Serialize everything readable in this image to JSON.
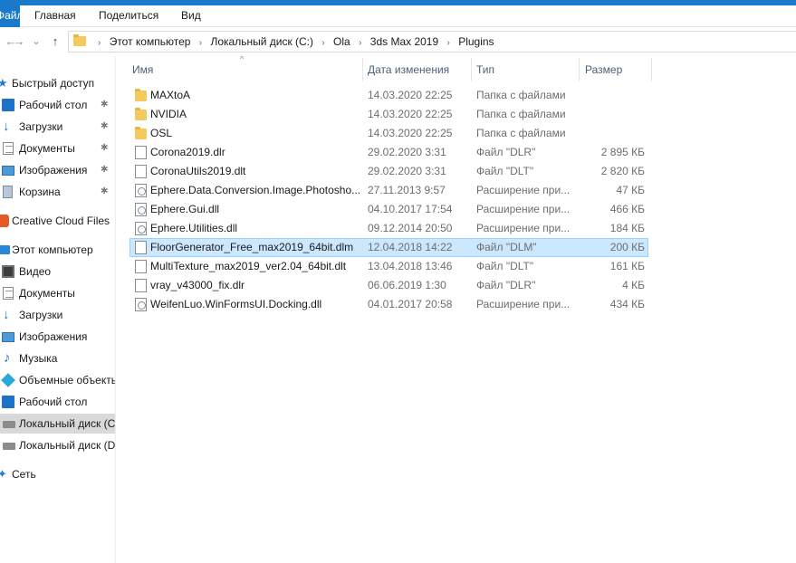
{
  "ribbon": {
    "file_tab": "Файл",
    "tabs": [
      "Главная",
      "Поделиться",
      "Вид"
    ]
  },
  "nav": {
    "back": "←",
    "forward": "→",
    "recent": "⌄",
    "up": "↑"
  },
  "address": {
    "crumbs": [
      "Этот компьютер",
      "Локальный диск (C:)",
      "Ola",
      "3ds Max 2019",
      "Plugins"
    ],
    "separator": "›"
  },
  "sidebar": {
    "items": [
      {
        "label": "Быстрый доступ",
        "icon": "star-icon",
        "pinned": false
      },
      {
        "label": "Рабочий стол",
        "icon": "desktop-icon",
        "pinned": true
      },
      {
        "label": "Загрузки",
        "icon": "download-icon",
        "pinned": true
      },
      {
        "label": "Документы",
        "icon": "documents-icon",
        "pinned": true
      },
      {
        "label": "Изображения",
        "icon": "pictures-icon",
        "pinned": true
      },
      {
        "label": "Корзина",
        "icon": "recycle-bin-icon",
        "pinned": true
      },
      {
        "label": "Creative Cloud Files",
        "icon": "creative-cloud-icon",
        "pinned": false
      },
      {
        "label": "Этот компьютер",
        "icon": "computer-icon",
        "pinned": false
      },
      {
        "label": "Видео",
        "icon": "video-icon",
        "pinned": false
      },
      {
        "label": "Документы",
        "icon": "documents-icon",
        "pinned": false
      },
      {
        "label": "Загрузки",
        "icon": "download-icon",
        "pinned": false
      },
      {
        "label": "Изображения",
        "icon": "pictures-icon",
        "pinned": false
      },
      {
        "label": "Музыка",
        "icon": "music-icon",
        "pinned": false
      },
      {
        "label": "Объемные объекты",
        "icon": "3d-objects-icon",
        "pinned": false
      },
      {
        "label": "Рабочий стол",
        "icon": "desktop-icon",
        "pinned": false
      },
      {
        "label": "Локальный диск (C:)",
        "icon": "drive-icon",
        "pinned": false
      },
      {
        "label": "Локальный диск (D:)",
        "icon": "drive-icon",
        "pinned": false
      },
      {
        "label": "Сеть",
        "icon": "network-icon",
        "pinned": false
      }
    ],
    "pin_glyph": "📌"
  },
  "columns": {
    "name": "Имя",
    "date": "Дата изменения",
    "type": "Тип",
    "size": "Размер",
    "sort_glyph": "^"
  },
  "files": [
    {
      "name": "MAXtoA",
      "date": "14.03.2020 22:25",
      "type": "Папка с файлами",
      "size": "",
      "kind": "folder"
    },
    {
      "name": "NVIDIA",
      "date": "14.03.2020 22:25",
      "type": "Папка с файлами",
      "size": "",
      "kind": "folder"
    },
    {
      "name": "OSL",
      "date": "14.03.2020 22:25",
      "type": "Папка с файлами",
      "size": "",
      "kind": "folder"
    },
    {
      "name": "Corona2019.dlr",
      "date": "29.02.2020 3:31",
      "type": "Файл \"DLR\"",
      "size": "2 895 КБ",
      "kind": "file"
    },
    {
      "name": "CoronaUtils2019.dlt",
      "date": "29.02.2020 3:31",
      "type": "Файл \"DLT\"",
      "size": "2 820 КБ",
      "kind": "file"
    },
    {
      "name": "Ephere.Data.Conversion.Image.Photosho...",
      "date": "27.11.2013 9:57",
      "type": "Расширение при...",
      "size": "47 КБ",
      "kind": "dll"
    },
    {
      "name": "Ephere.Gui.dll",
      "date": "04.10.2017 17:54",
      "type": "Расширение при...",
      "size": "466 КБ",
      "kind": "dll"
    },
    {
      "name": "Ephere.Utilities.dll",
      "date": "09.12.2014 20:50",
      "type": "Расширение при...",
      "size": "184 КБ",
      "kind": "dll"
    },
    {
      "name": "FloorGenerator_Free_max2019_64bit.dlm",
      "date": "12.04.2018 14:22",
      "type": "Файл \"DLM\"",
      "size": "200 КБ",
      "kind": "file",
      "selected": true
    },
    {
      "name": "MultiTexture_max2019_ver2.04_64bit.dlt",
      "date": "13.04.2018 13:46",
      "type": "Файл \"DLT\"",
      "size": "161 КБ",
      "kind": "file"
    },
    {
      "name": "vray_v43000_fix.dlr",
      "date": "06.06.2019 1:30",
      "type": "Файл \"DLR\"",
      "size": "4 КБ",
      "kind": "file"
    },
    {
      "name": "WeifenLuo.WinFormsUI.Docking.dll",
      "date": "04.01.2017 20:58",
      "type": "Расширение при...",
      "size": "434 КБ",
      "kind": "dll"
    }
  ]
}
